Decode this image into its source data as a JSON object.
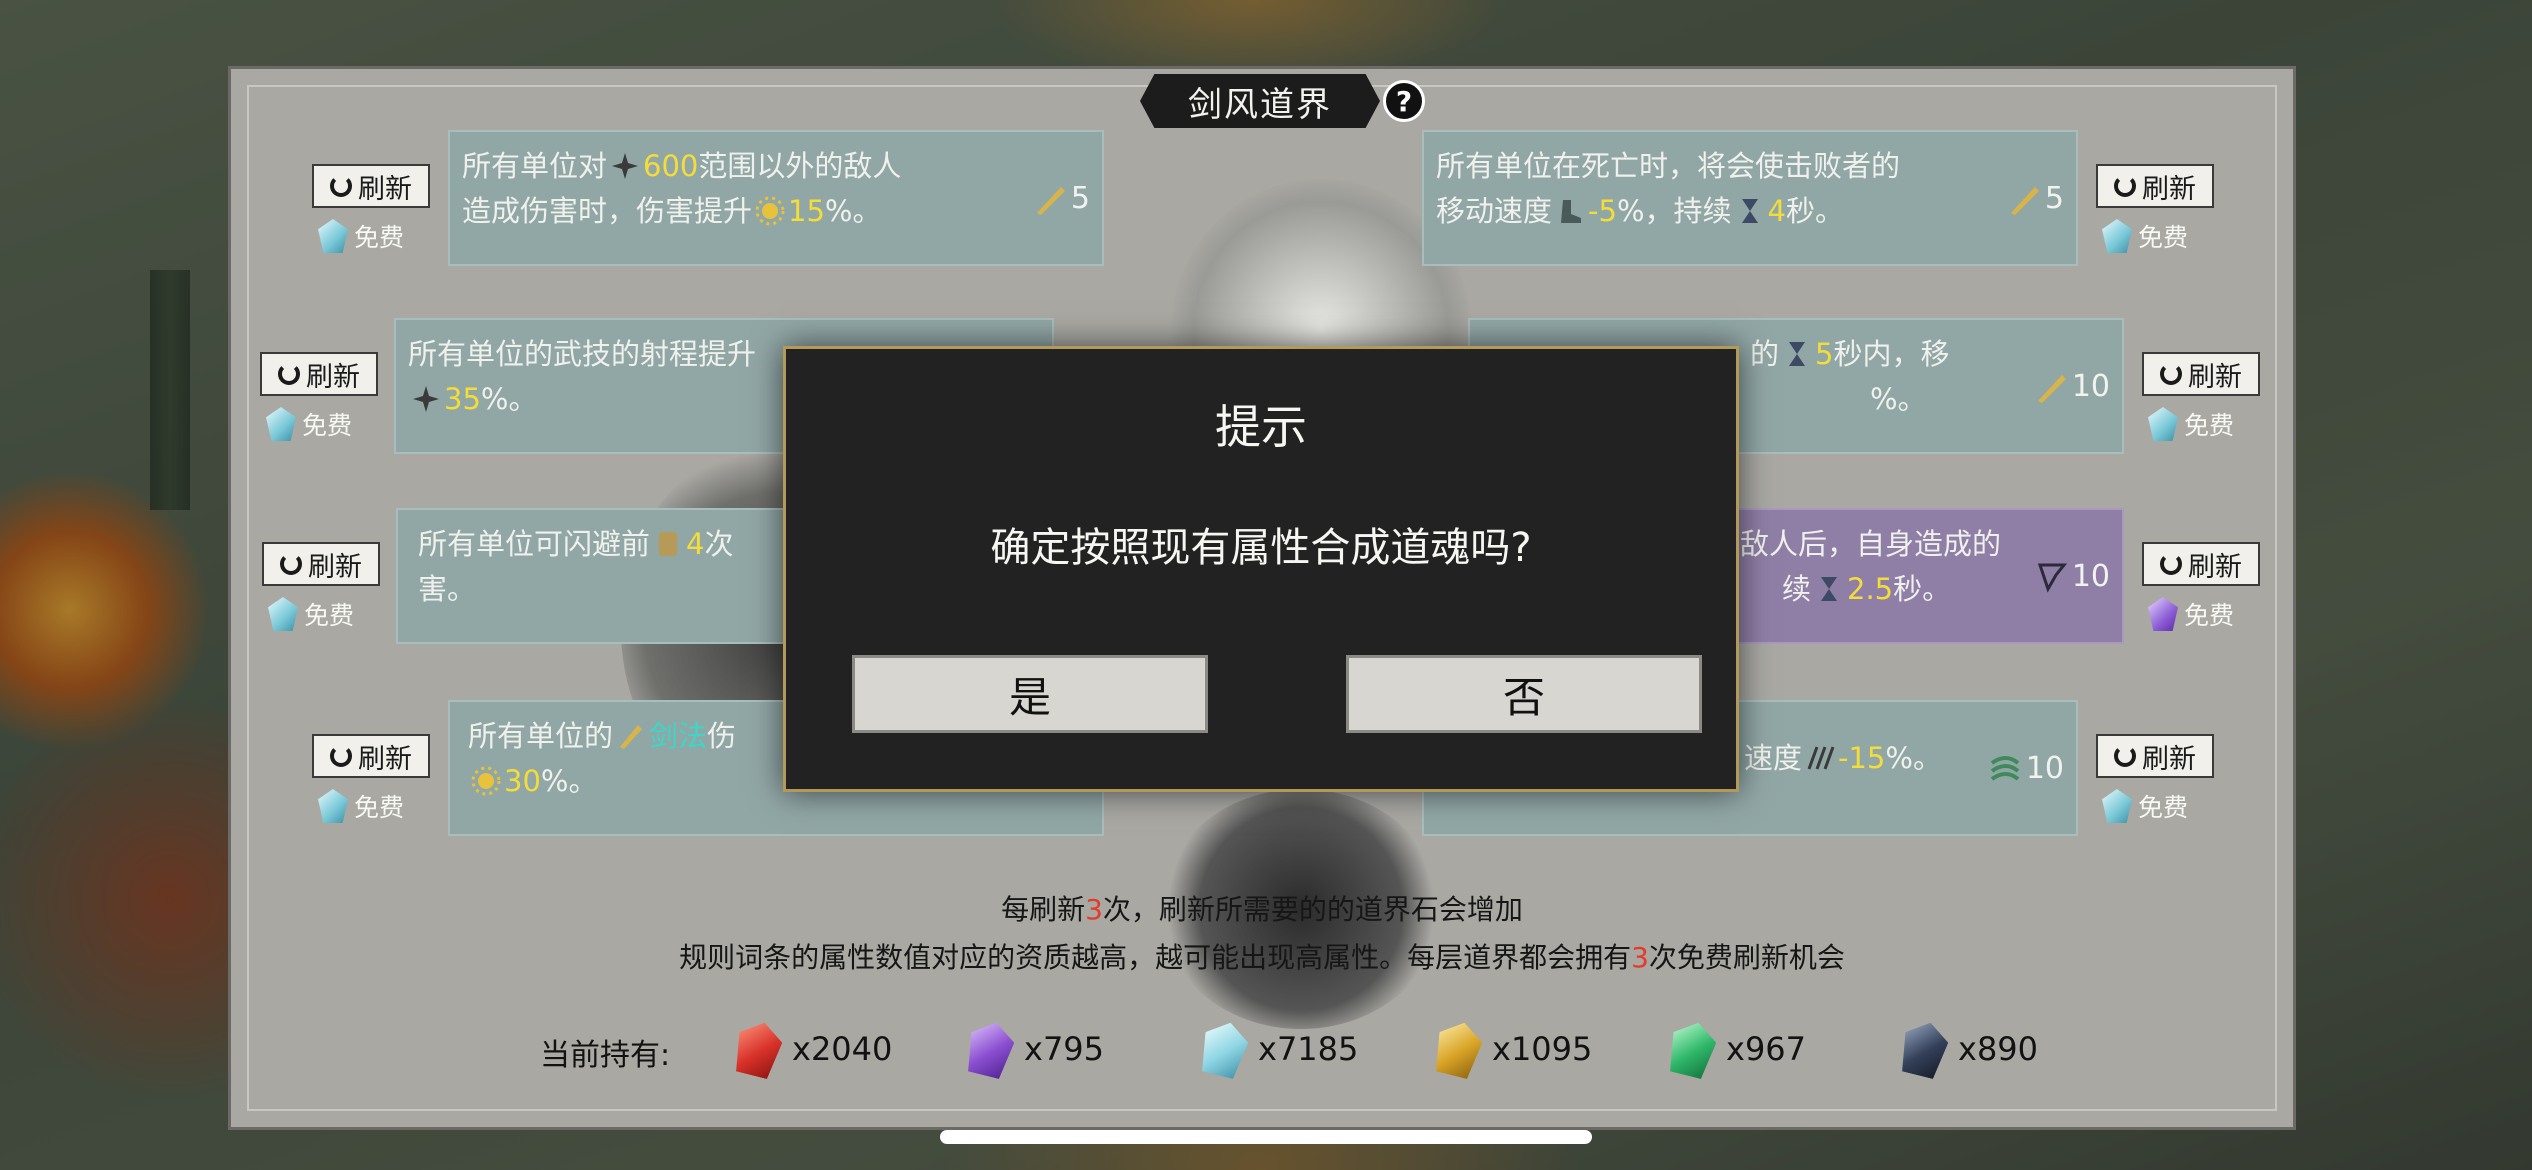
{
  "title": "剑风道界",
  "help_symbol": "?",
  "refresh_label": "刷新",
  "free_label": "免费",
  "rules": [
    {
      "pre": "所有单位对",
      "value1": "600",
      "mid": "范围以外的敌人",
      "line2_pre": "造成伤害时，伤害提升",
      "value2": "15",
      "line2_post": "%。",
      "grade": "5"
    },
    {
      "line1": "所有单位在死亡时，将会使击败者的",
      "line2_pre": "移动速度",
      "value1": "-5",
      "line2_mid": "%，持续",
      "value2": "4",
      "line2_post": "秒。",
      "grade": "5"
    },
    {
      "line1": "所有单位的武技的射程提升",
      "value1": "35",
      "line2_post": "%。"
    },
    {
      "line1_pre": "的",
      "value1": "5",
      "line1_post": "秒内，移",
      "line2_post": "%。",
      "grade": "10"
    },
    {
      "line1_pre": "所有单位可闪避前",
      "value1": "4",
      "line1_post": "次",
      "line2": "害。"
    },
    {
      "line1": "敌人后，自身造成的",
      "line2_pre": "续",
      "value1": "2.5",
      "line2_post": "秒。",
      "grade": "10"
    },
    {
      "line1_pre": "所有单位的",
      "value1": "剑法",
      "line1_post": "伤",
      "value2": "30",
      "line2_post": "%。"
    },
    {
      "line1_pre": "速度",
      "value1": "-15",
      "line1_post": "%。",
      "grade": "10"
    }
  ],
  "info_line1": {
    "pre": "每刷新",
    "num": "3",
    "post": "次，刷新所需要的的道界石会增加"
  },
  "info_line2": {
    "pre": "规则词条的属性数值对应的资质越高，越可能出现高属性。每层道界都会拥有",
    "num": "3",
    "post": "次免费刷新机会"
  },
  "holdings_label": "当前持有:",
  "currencies": [
    {
      "icon": "red-crystal-icon",
      "color": "#d8322a",
      "amount": "x2040"
    },
    {
      "icon": "purple-crystal-icon",
      "color": "#8a4fd0",
      "amount": "x795"
    },
    {
      "icon": "cyan-crystal-icon",
      "color": "#8fd6e4",
      "amount": "x7185"
    },
    {
      "icon": "gold-crystal-icon",
      "color": "#d9a426",
      "amount": "x1095"
    },
    {
      "icon": "green-crystal-icon",
      "color": "#2fb86a",
      "amount": "x967"
    },
    {
      "icon": "dark-crystal-icon",
      "color": "#34405a",
      "amount": "x890"
    }
  ],
  "dialog": {
    "title": "提示",
    "message": "确定按照现有属性合成道魂吗?",
    "yes": "是",
    "no": "否"
  },
  "colors": {
    "highlight": "#f4dc3a",
    "accent_red": "#e23b2c",
    "dialog_border": "#b39a58"
  }
}
